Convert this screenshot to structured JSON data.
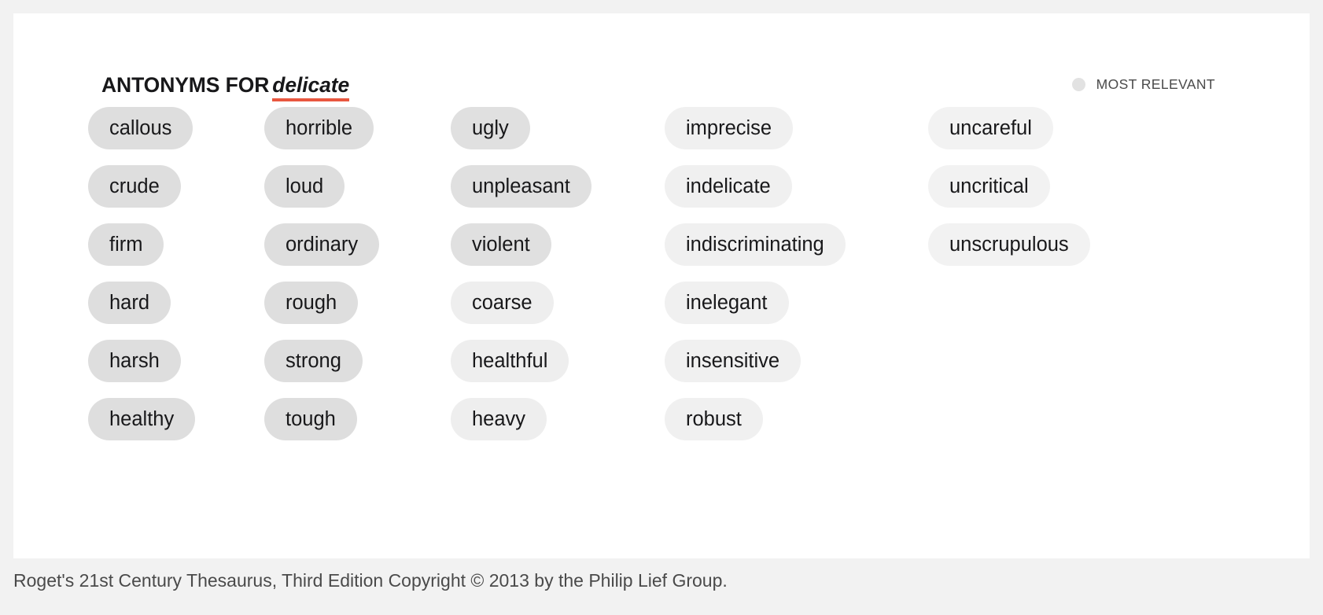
{
  "header": {
    "label": "ANTONYMS FOR",
    "term": "delicate",
    "term_underline_color": "#e8573f"
  },
  "relevance_legend": {
    "icon": "circle-icon",
    "label": "MOST RELEVANT",
    "dot_color": "#e2e2e2"
  },
  "columns": [
    {
      "index": 1,
      "chips": [
        {
          "label": "callous",
          "bg": "#dedede"
        },
        {
          "label": "crude",
          "bg": "#dedede"
        },
        {
          "label": "firm",
          "bg": "#dedede"
        },
        {
          "label": "hard",
          "bg": "#dedede"
        },
        {
          "label": "harsh",
          "bg": "#dedede"
        },
        {
          "label": "healthy",
          "bg": "#dedede"
        }
      ]
    },
    {
      "index": 2,
      "chips": [
        {
          "label": "horrible",
          "bg": "#dedede"
        },
        {
          "label": "loud",
          "bg": "#dedede"
        },
        {
          "label": "ordinary",
          "bg": "#dedede"
        },
        {
          "label": "rough",
          "bg": "#dedede"
        },
        {
          "label": "strong",
          "bg": "#dedede"
        },
        {
          "label": "tough",
          "bg": "#dedede"
        }
      ]
    },
    {
      "index": 3,
      "chips": [
        {
          "label": "ugly",
          "bg": "#e0e0e0"
        },
        {
          "label": "unpleasant",
          "bg": "#e0e0e0"
        },
        {
          "label": "violent",
          "bg": "#e0e0e0"
        },
        {
          "label": "coarse",
          "bg": "#eeeeee"
        },
        {
          "label": "healthful",
          "bg": "#eeeeee"
        },
        {
          "label": "heavy",
          "bg": "#eeeeee"
        }
      ]
    },
    {
      "index": 4,
      "chips": [
        {
          "label": "imprecise",
          "bg": "#f0f0f0"
        },
        {
          "label": "indelicate",
          "bg": "#f0f0f0"
        },
        {
          "label": "indiscriminating",
          "bg": "#f0f0f0"
        },
        {
          "label": "inelegant",
          "bg": "#f0f0f0"
        },
        {
          "label": "insensitive",
          "bg": "#f0f0f0"
        },
        {
          "label": "robust",
          "bg": "#f0f0f0"
        }
      ]
    },
    {
      "index": 5,
      "chips": [
        {
          "label": "uncareful",
          "bg": "#f2f2f2"
        },
        {
          "label": "uncritical",
          "bg": "#f2f2f2"
        },
        {
          "label": "unscrupulous",
          "bg": "#f2f2f2"
        }
      ]
    }
  ],
  "footer": {
    "attribution": "Roget's 21st Century Thesaurus, Third Edition Copyright © 2013 by the Philip Lief Group."
  }
}
